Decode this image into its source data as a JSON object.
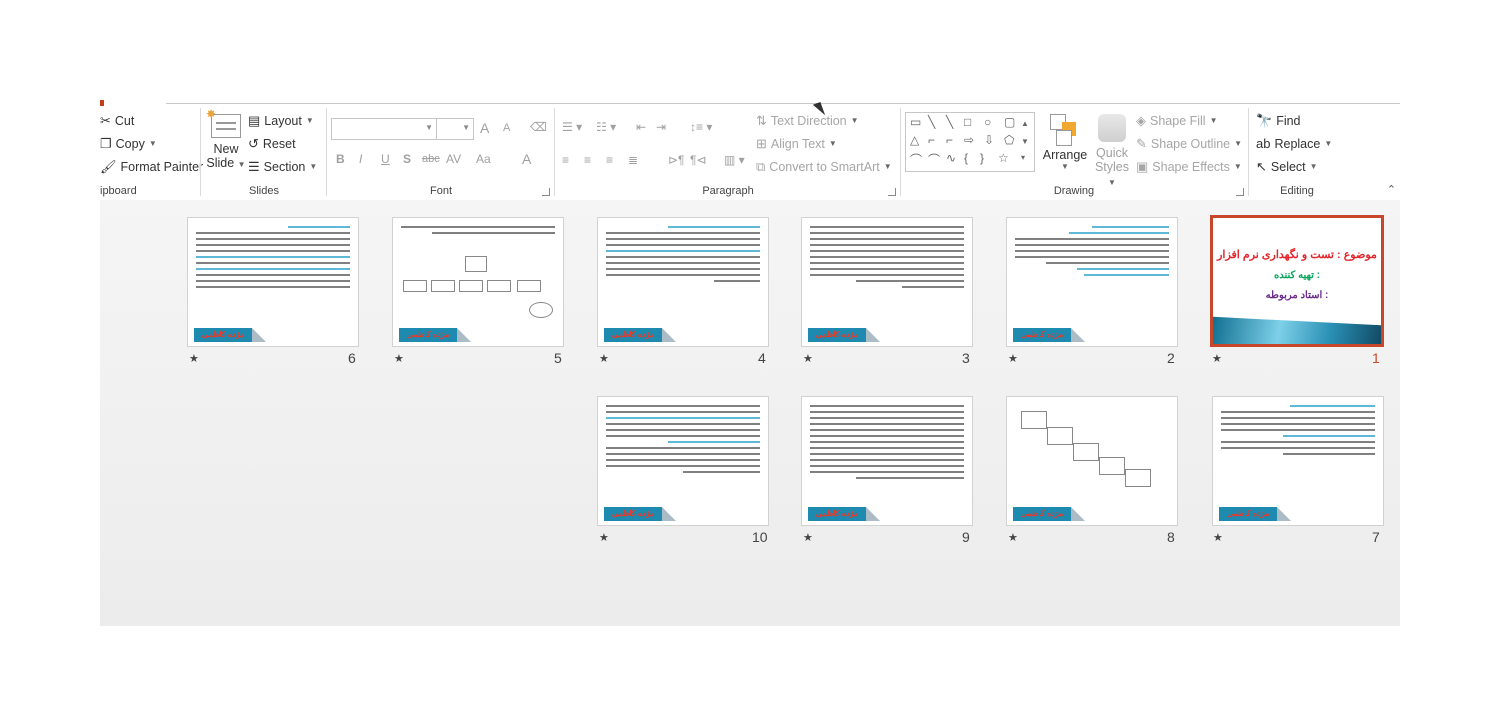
{
  "clipboard": {
    "cut": "Cut",
    "copy": "Copy",
    "format_painter": "Format Painter",
    "label": "ipboard"
  },
  "slides_group": {
    "new_slide_line1": "New",
    "new_slide_line2": "Slide",
    "layout": "Layout",
    "reset": "Reset",
    "section": "Section",
    "label": "Slides"
  },
  "font_group": {
    "label": "Font",
    "bold": "B",
    "italic": "I",
    "underline": "U",
    "shadow": "S",
    "strike": "abc",
    "spacing": "AV",
    "case": "Aa",
    "color": "A",
    "grow": "A",
    "shrink": "A"
  },
  "paragraph_group": {
    "text_direction": "Text Direction",
    "align_text": "Align Text",
    "convert_smartart": "Convert to SmartArt",
    "label": "Paragraph"
  },
  "drawing_group": {
    "arrange": "Arrange",
    "quick_styles_line1": "Quick",
    "quick_styles_line2": "Styles",
    "shape_fill": "Shape Fill",
    "shape_outline": "Shape Outline",
    "shape_effects": "Shape Effects",
    "label": "Drawing"
  },
  "editing_group": {
    "find": "Find",
    "replace": "Replace",
    "select": "Select",
    "label": "Editing"
  },
  "slides": [
    {
      "num": "1",
      "selected": true,
      "title": "موضوع : تست و نگهداری نرم افزار",
      "prepared": "تهیه کننده :",
      "teacher": "استاد مربوطه :"
    },
    {
      "num": "2",
      "footer": "مژده کاظمی",
      "page": "۱"
    },
    {
      "num": "3",
      "footer": "مژده کاظمی",
      "page": "۲"
    },
    {
      "num": "4",
      "footer": "مژده کاظمی",
      "page": "۳"
    },
    {
      "num": "5",
      "footer": "مژده کاظمی",
      "page": "۴"
    },
    {
      "num": "6",
      "footer": "مژده کاظمی",
      "page": "۵"
    },
    {
      "num": "7",
      "footer": "مژده کاظمی",
      "page": "۶"
    },
    {
      "num": "8",
      "footer": "مژده کاظمی",
      "page": "۷"
    },
    {
      "num": "9",
      "footer": "مژده کاظمی",
      "page": "۸"
    },
    {
      "num": "10",
      "footer": "مژده کاظمی",
      "page": "۹"
    }
  ],
  "star": "★"
}
